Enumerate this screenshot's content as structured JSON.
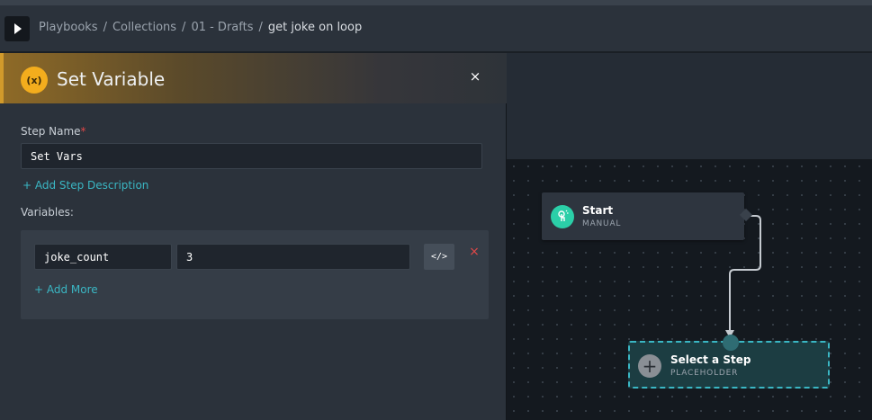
{
  "breadcrumb": {
    "items": [
      "Playbooks",
      "Collections",
      "01 - Drafts"
    ],
    "current": "get joke on loop",
    "separator": "/"
  },
  "panel": {
    "title": "Set Variable",
    "icon_text": "(x)",
    "close_glyph": "×",
    "step_name_label": "Step Name",
    "required_mark": "*",
    "step_name_value": "Set Vars",
    "add_description": "+ Add Step Description",
    "variables_label": "Variables:",
    "variables": [
      {
        "name": "joke_count",
        "value": "3"
      }
    ],
    "code_toggle": "</>",
    "remove_glyph": "×",
    "add_more": "+ Add More"
  },
  "canvas": {
    "start_node": {
      "title": "Start",
      "subtitle": "MANUAL"
    },
    "placeholder_node": {
      "title": "Select a Step",
      "subtitle": "PLACEHOLDER",
      "plus": "+"
    }
  },
  "colors": {
    "accent_teal": "#3ab7c4",
    "start_green": "#2bcfa8",
    "variable_orange": "#f3ad1d",
    "required_red": "#e04848"
  },
  "icons": {
    "toggle": "play-triangle-icon",
    "variable": "variable-icon",
    "close": "close-icon",
    "code": "code-icon",
    "remove": "remove-icon",
    "start": "touch-icon",
    "add_step": "plus-icon"
  }
}
